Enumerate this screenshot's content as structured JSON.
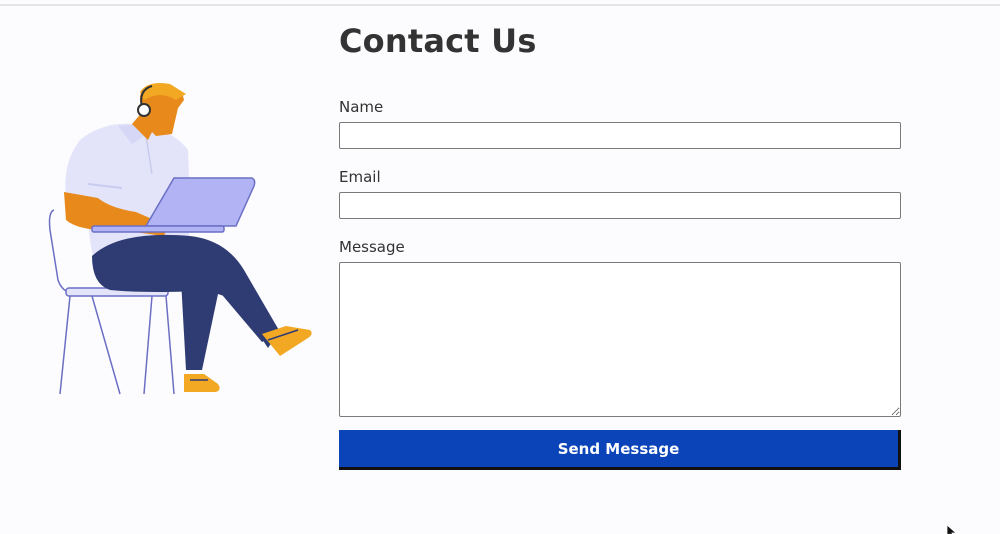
{
  "page": {
    "title": "Contact Us"
  },
  "form": {
    "name_label": "Name",
    "name_value": "",
    "email_label": "Email",
    "email_value": "",
    "message_label": "Message",
    "message_value": "",
    "submit_label": "Send Message"
  },
  "illustration": {
    "icon": "person-with-laptop-on-chair-illustration",
    "colors": {
      "skin": "#e8891b",
      "shirt": "#e3e4fa",
      "laptop": "#b1b3f5",
      "pants": "#2f3c73",
      "shoes": "#f2a823",
      "chair_line": "#6b6fc4"
    }
  },
  "colors": {
    "accent": "#0b44b8",
    "text": "#333333",
    "background": "#fcfbfd"
  }
}
